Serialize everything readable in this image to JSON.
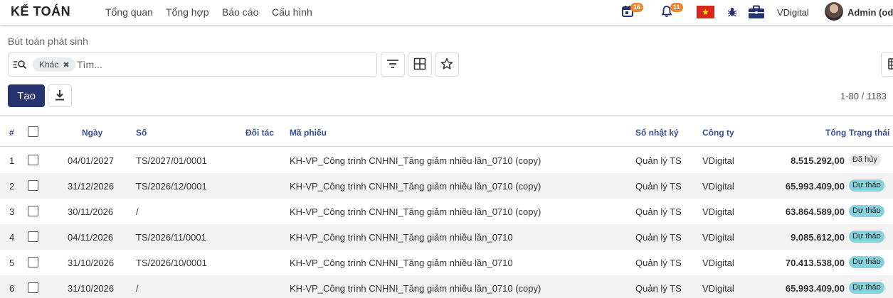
{
  "navbar": {
    "app_title": "KẾ TOÁN",
    "menu": [
      "Tổng quan",
      "Tổng hợp",
      "Báo cáo",
      "Cấu hình"
    ],
    "activity_count": "16",
    "notification_count": "11",
    "company": "VDigital",
    "user": "Admin (odo"
  },
  "control": {
    "breadcrumb": "Bút toán phát sinh",
    "facet_label": "Khác",
    "search_placeholder": "Tìm...",
    "create_label": "Tạo",
    "pager": "1-80 / 1183"
  },
  "table": {
    "headers": {
      "index": "#",
      "date": "Ngày",
      "number": "Số",
      "partner": "Đối tác",
      "voucher": "Mã phiếu",
      "journal": "Sổ nhật ký",
      "company": "Công ty",
      "total": "Tổng",
      "status": "Trạng thái"
    },
    "rows": [
      {
        "idx": "1",
        "date": "04/01/2027",
        "number": "TS/2027/01/0001",
        "voucher": "KH-VP_Công trình CNHNI_Tăng giảm nhiều lần_0710 (copy)",
        "journal": "Quản lý TS",
        "company": "VDigital",
        "total": "8.515.292,00",
        "status": "Đã hủy",
        "status_type": "cancel"
      },
      {
        "idx": "2",
        "date": "31/12/2026",
        "number": "TS/2026/12/0001",
        "voucher": "KH-VP_Công trình CNHNI_Tăng giảm nhiều lần_0710 (copy)",
        "journal": "Quản lý TS",
        "company": "VDigital",
        "total": "65.993.409,00",
        "status": "Dự thảo",
        "status_type": "draft"
      },
      {
        "idx": "3",
        "date": "30/11/2026",
        "number": "/",
        "voucher": "KH-VP_Công trình CNHNI_Tăng giảm nhiều lần_0710 (copy)",
        "journal": "Quản lý TS",
        "company": "VDigital",
        "total": "63.864.589,00",
        "status": "Dự thảo",
        "status_type": "draft"
      },
      {
        "idx": "4",
        "date": "04/11/2026",
        "number": "TS/2026/11/0001",
        "voucher": "KH-VP_Công trình CNHNI_Tăng giảm nhiều lần_0710",
        "journal": "Quản lý TS",
        "company": "VDigital",
        "total": "9.085.612,00",
        "status": "Dự thảo",
        "status_type": "draft"
      },
      {
        "idx": "5",
        "date": "31/10/2026",
        "number": "TS/2026/10/0001",
        "voucher": "KH-VP_Công trình CNHNI_Tăng giảm nhiều lần_0710",
        "journal": "Quản lý TS",
        "company": "VDigital",
        "total": "70.413.538,00",
        "status": "Dự thảo",
        "status_type": "draft"
      },
      {
        "idx": "6",
        "date": "31/10/2026",
        "number": "/",
        "voucher": "KH-VP_Công trình CNHNI_Tăng giảm nhiều lần_0710 (copy)",
        "journal": "Quản lý TS",
        "company": "VDigital",
        "total": "65.993.409,00",
        "status": "Dự thảo",
        "status_type": "draft"
      }
    ]
  },
  "colors": {
    "primary": "#27336e",
    "header_text": "#35509a",
    "badge": "#f0842c",
    "draft_status": "#85d1dc",
    "cancel_status": "#e9e9e9"
  },
  "icons": [
    "calendar-icon",
    "bell-icon",
    "vietnam-flag-icon",
    "bug-icon",
    "briefcase-icon",
    "search-icon",
    "filter-icon",
    "group-by-icon",
    "favorite-star-icon",
    "download-icon",
    "list-view-icon"
  ]
}
